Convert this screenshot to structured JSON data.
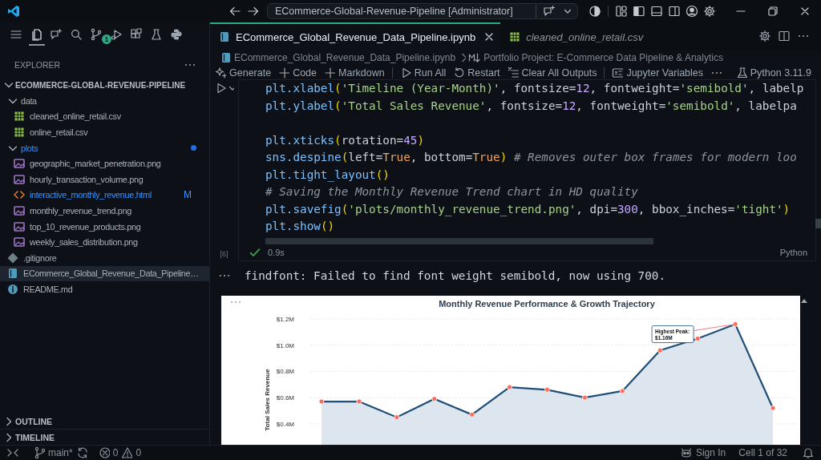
{
  "title_bar": {
    "command_center": "ECommerce-Global-Revenue-Pipeline [Administrator]"
  },
  "activity_bar": [
    {
      "kind": "menu",
      "selected": false
    },
    {
      "kind": "explorer",
      "selected": true
    },
    {
      "kind": "chat",
      "selected": false
    },
    {
      "kind": "search",
      "selected": false
    },
    {
      "kind": "source_control",
      "selected": false,
      "badge": "1"
    },
    {
      "kind": "run",
      "selected": false
    },
    {
      "kind": "extensions",
      "selected": false
    },
    {
      "kind": "testing",
      "selected": false
    },
    {
      "kind": "python",
      "selected": false
    }
  ],
  "sidebar": {
    "title": "EXPLORER",
    "project": {
      "label": "ECOMMERCE-GLOBAL-REVENUE-PIPELINE",
      "expanded": true,
      "children": [
        {
          "label": "data",
          "kind": "folder",
          "expanded": true,
          "selected": false,
          "modified": false,
          "children": [
            {
              "label": "cleaned_online_retail.csv",
              "kind": "csv",
              "selected": false,
              "modified": false
            },
            {
              "label": "online_retail.csv",
              "kind": "csv",
              "selected": false,
              "modified": false
            }
          ]
        },
        {
          "label": "plots",
          "kind": "folder",
          "expanded": true,
          "selected": false,
          "modified": true,
          "children": [
            {
              "label": "geographic_market_penetration.png",
              "kind": "image",
              "selected": false,
              "modified": false
            },
            {
              "label": "hourly_transaction_volume.png",
              "kind": "image",
              "selected": false,
              "modified": false
            },
            {
              "label": "interactive_monthly_revenue.html",
              "kind": "html",
              "selected": false,
              "modified": true,
              "badge": "M"
            },
            {
              "label": "monthly_revenue_trend.png",
              "kind": "image",
              "selected": false,
              "modified": false
            },
            {
              "label": "top_10_revenue_products.png",
              "kind": "image",
              "selected": false,
              "modified": false
            },
            {
              "label": "weekly_sales_distribution.png",
              "kind": "image",
              "selected": false,
              "modified": false
            }
          ]
        },
        {
          "label": ".gitignore",
          "kind": "git",
          "selected": false,
          "modified": false
        },
        {
          "label": "ECommerce_Global_Revenue_Data_Pipeline…",
          "kind": "notebook",
          "selected": true,
          "modified": false
        },
        {
          "label": "README.md",
          "kind": "markdown",
          "selected": false,
          "modified": false
        }
      ]
    },
    "panels": [
      {
        "label": "OUTLINE",
        "expanded": false
      },
      {
        "label": "TIMELINE",
        "expanded": false
      }
    ]
  },
  "tabs": [
    {
      "label": "ECommerce_Global_Revenue_Data_Pipeline.ipynb",
      "kind": "notebook",
      "selected": true,
      "preview": false
    },
    {
      "label": "cleaned_online_retail.csv",
      "kind": "csv",
      "selected": false,
      "preview": true
    }
  ],
  "breadcrumb": [
    {
      "label": "ECommerce_Global_Revenue_Data_Pipeline.ipynb",
      "kind": "notebook"
    },
    {
      "label": "Portfolio Project: E-Commerce Data Pipeline & Analytics",
      "kind": "markdown"
    }
  ],
  "toolbar": {
    "items": [
      {
        "kind": "generate",
        "label": "Generate"
      },
      {
        "kind": "add",
        "label": "Code"
      },
      {
        "kind": "add",
        "label": "Markdown"
      },
      {
        "kind": "separator"
      },
      {
        "kind": "run_all",
        "label": "Run All"
      },
      {
        "kind": "restart",
        "label": "Restart"
      },
      {
        "kind": "clear",
        "label": "Clear All Outputs"
      },
      {
        "kind": "separator"
      },
      {
        "kind": "variables",
        "label": "Jupyter Variables"
      },
      {
        "kind": "more"
      }
    ],
    "kernel": "Python 3.11.9"
  },
  "cell": {
    "execution_count": "[6]",
    "succeeded": true,
    "duration": "0.9s",
    "language": "Python",
    "lines": [
      {
        "kind": "code",
        "tokens": [
          {
            "kind": "id",
            "text": "plt.xlabel"
          },
          {
            "kind": "b",
            "text": "("
          },
          {
            "kind": "s",
            "text": "'Timeline (Year-Month)'"
          },
          {
            "kind": "p",
            "text": ", fontsize="
          },
          {
            "kind": "n",
            "text": "12"
          },
          {
            "kind": "p",
            "text": ", fontweight="
          },
          {
            "kind": "s",
            "text": "'semibold'"
          },
          {
            "kind": "p",
            "text": ", labelp"
          }
        ]
      },
      {
        "kind": "code",
        "tokens": [
          {
            "kind": "id",
            "text": "plt.ylabel"
          },
          {
            "kind": "b",
            "text": "("
          },
          {
            "kind": "s",
            "text": "'Total Sales Revenue'"
          },
          {
            "kind": "p",
            "text": ", fontsize="
          },
          {
            "kind": "n",
            "text": "12"
          },
          {
            "kind": "p",
            "text": ", fontweight="
          },
          {
            "kind": "s",
            "text": "'semibold'"
          },
          {
            "kind": "p",
            "text": ", labelpa"
          }
        ]
      },
      {
        "kind": "blank"
      },
      {
        "kind": "code",
        "tokens": [
          {
            "kind": "id",
            "text": "plt.xticks"
          },
          {
            "kind": "b",
            "text": "("
          },
          {
            "kind": "p",
            "text": "rotation="
          },
          {
            "kind": "n",
            "text": "45"
          },
          {
            "kind": "b",
            "text": ")"
          }
        ]
      },
      {
        "kind": "code",
        "tokens": [
          {
            "kind": "id",
            "text": "sns.despine"
          },
          {
            "kind": "b",
            "text": "("
          },
          {
            "kind": "p",
            "text": "left="
          },
          {
            "kind": "k",
            "text": "True"
          },
          {
            "kind": "p",
            "text": ", bottom="
          },
          {
            "kind": "k",
            "text": "True"
          },
          {
            "kind": "b",
            "text": ")"
          },
          {
            "kind": "c",
            "text": " # Removes outer box frames for modern loo"
          }
        ]
      },
      {
        "kind": "code",
        "tokens": [
          {
            "kind": "id",
            "text": "plt.tight_layout"
          },
          {
            "kind": "b",
            "text": "()"
          }
        ]
      },
      {
        "kind": "code",
        "tokens": [
          {
            "kind": "c",
            "text": "# Saving the Monthly Revenue Trend chart in HD quality"
          }
        ]
      },
      {
        "kind": "code",
        "tokens": [
          {
            "kind": "id",
            "text": "plt.savefig"
          },
          {
            "kind": "b",
            "text": "("
          },
          {
            "kind": "s",
            "text": "'plots/monthly_revenue_trend.png'"
          },
          {
            "kind": "p",
            "text": ", dpi="
          },
          {
            "kind": "n",
            "text": "300"
          },
          {
            "kind": "p",
            "text": ", bbox_inches="
          },
          {
            "kind": "s",
            "text": "'tight'"
          },
          {
            "kind": "b",
            "text": ")"
          }
        ]
      },
      {
        "kind": "code",
        "tokens": [
          {
            "kind": "id",
            "text": "plt.show"
          },
          {
            "kind": "b",
            "text": "()"
          }
        ]
      }
    ]
  },
  "outputs": [
    {
      "kind": "text",
      "text": "findfont: Failed to find font weight semibold, now using 700."
    },
    {
      "kind": "chart",
      "chart_data": {
        "type": "area",
        "title": "Monthly Revenue Performance & Growth Trajectory",
        "ylabel": "Total Sales Revenue",
        "grid": true,
        "series": [
          {
            "color": "#1f4e79",
            "marker": true,
            "values": [
              0.57,
              0.57,
              0.45,
              0.59,
              0.47,
              0.68,
              0.66,
              0.6,
              0.65,
              0.96,
              1.05,
              1.16,
              0.52
            ]
          }
        ],
        "yticks": [
          {
            "value": 0.4,
            "label": "$0.4M"
          },
          {
            "value": 0.6,
            "label": "$0.6M"
          },
          {
            "value": 0.8,
            "label": "$0.8M"
          },
          {
            "value": 1.0,
            "label": "$1.0M"
          },
          {
            "value": 1.2,
            "label": "$1.2M"
          }
        ],
        "ylim": [
          0.24,
          1.2
        ],
        "annotations": [
          {
            "text": "Highest Peak:\n$1.16M"
          }
        ]
      }
    }
  ],
  "status_bar": {
    "branch": "main*",
    "errors": "0",
    "warnings": "0",
    "sign_in": "Sign In",
    "cell_position": "Cell 1 of 32"
  }
}
